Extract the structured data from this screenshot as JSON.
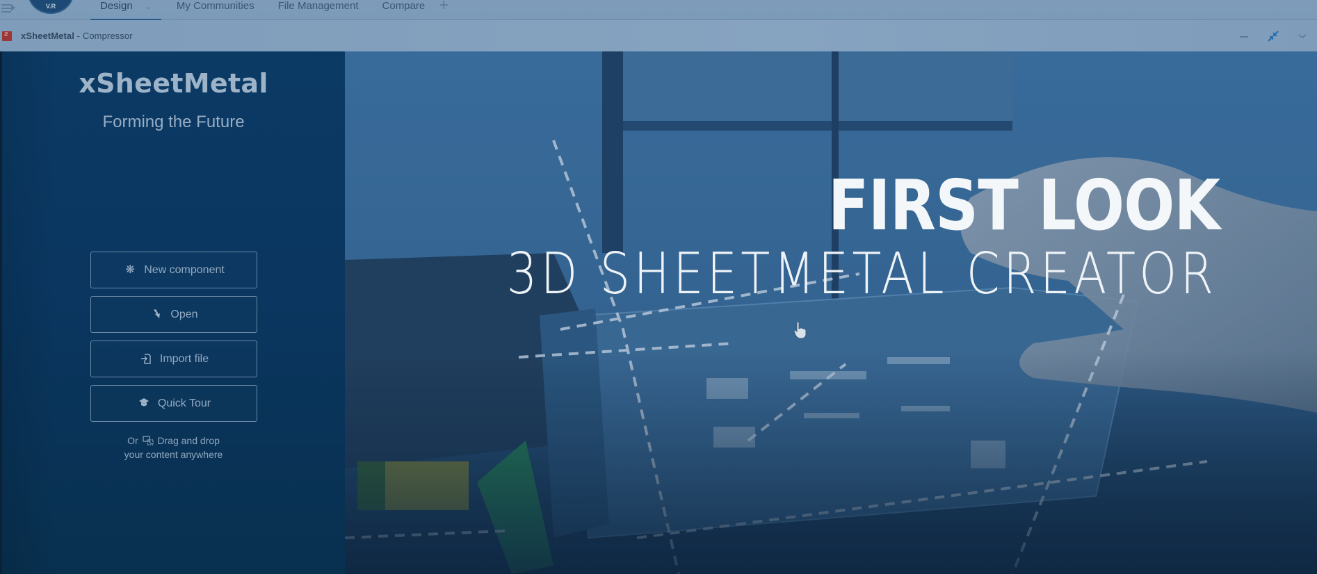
{
  "topnav": {
    "badge_text": "V.R",
    "tabs": [
      {
        "label": "Design",
        "active": true,
        "has_dropdown": true
      },
      {
        "label": "My Communities",
        "active": false
      },
      {
        "label": "File Management",
        "active": false
      },
      {
        "label": "Compare",
        "active": false
      }
    ],
    "add_tab_icon": "plus-icon",
    "menu_icon": "collapse-menu-icon"
  },
  "window": {
    "app_icon": "3ds-app-icon",
    "title_app": "xSheetMetal",
    "title_separator": " - ",
    "title_doc": "Compressor",
    "controls": [
      "minimize-icon",
      "restore-icon",
      "chevron-down-icon"
    ]
  },
  "left_panel": {
    "brand": "xSheetMetal",
    "tagline": "Forming the Future",
    "buttons": [
      {
        "label": "New component",
        "icon": "asterisk-icon"
      },
      {
        "label": "Open",
        "icon": "open-arrow-icon"
      },
      {
        "label": "Import file",
        "icon": "import-file-icon"
      },
      {
        "label": "Quick Tour",
        "icon": "graduation-cap-icon"
      }
    ],
    "drop_hint_prefix": "Or",
    "drop_hint_action": "Drag and drop",
    "drop_hint_line2": "your content anywhere"
  },
  "hero": {
    "title": "FIRST LOOK",
    "subtitle": "3D SHEETMETAL CREATOR",
    "colors": {
      "text": "#f4f7fa",
      "tint": "#2f6090"
    }
  },
  "colors": {
    "nav_bg": "#7e9cba",
    "panel_bg": "#0a3660",
    "active_tab_underline": "#295a87"
  }
}
